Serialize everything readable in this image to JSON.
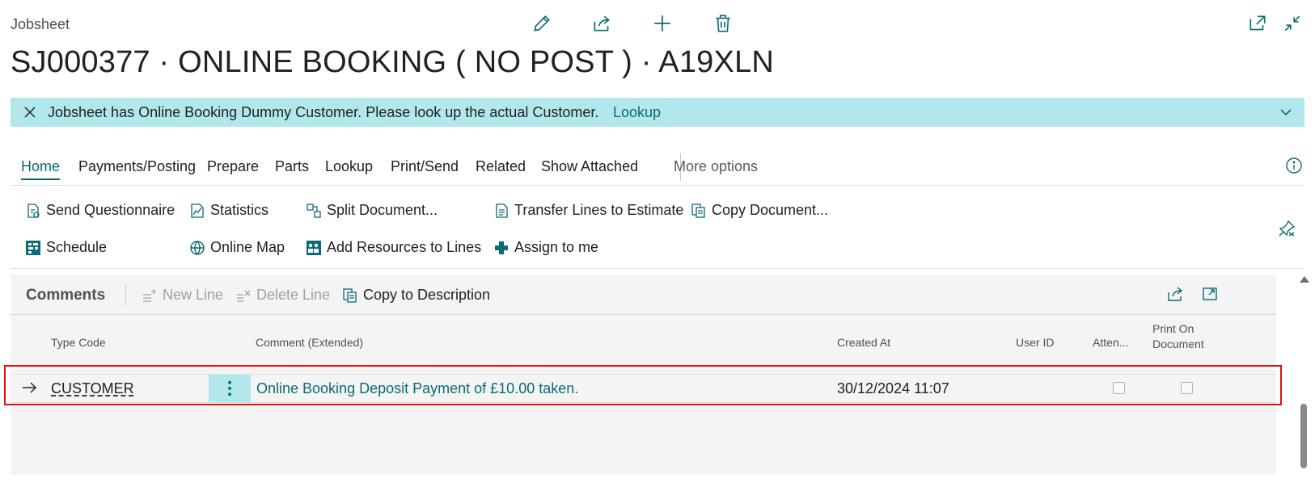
{
  "page": {
    "caption": "Jobsheet",
    "title": "SJ000377 · ONLINE BOOKING ( NO POST ) · A19XLN"
  },
  "top_icons": [
    "edit-icon",
    "share-icon",
    "add-icon",
    "delete-icon",
    "open-new-window-icon",
    "collapse-icon"
  ],
  "notification": {
    "message": "Jobsheet has Online Booking Dummy Customer. Please look up the actual Customer.",
    "link": "Lookup"
  },
  "tabs": [
    {
      "label": "Home",
      "active": true
    },
    {
      "label": "Payments/Posting"
    },
    {
      "label": "Prepare"
    },
    {
      "label": "Parts"
    },
    {
      "label": "Lookup"
    },
    {
      "label": "Print/Send"
    },
    {
      "label": "Related"
    },
    {
      "label": "Show Attached"
    },
    {
      "label": "More options"
    }
  ],
  "actions": {
    "send_questionnaire": "Send Questionnaire",
    "statistics": "Statistics",
    "split_document": "Split Document...",
    "transfer_lines": "Transfer Lines to Estimate",
    "copy_document": "Copy Document...",
    "schedule": "Schedule",
    "online_map": "Online Map",
    "add_resources": "Add Resources to Lines",
    "assign_to_me": "Assign to me"
  },
  "comments": {
    "title": "Comments",
    "new_line": "New Line",
    "delete_line": "Delete Line",
    "copy_to_description": "Copy to Description",
    "columns": {
      "type_code": "Type Code",
      "comment": "Comment (Extended)",
      "created_at": "Created At",
      "user_id": "User ID",
      "attention": "Atten...",
      "print_on_document_1": "Print On",
      "print_on_document_2": "Document"
    },
    "rows": [
      {
        "type_code": "CUSTOMER",
        "comment": "Online Booking Deposit Payment of £10.00 taken.",
        "created_at": "30/12/2024 11:07",
        "user_id": "",
        "attention": false,
        "print_on_document": false
      }
    ]
  },
  "colors": {
    "accent": "#0b6a73",
    "notification_bg": "#b2e8eb",
    "highlight_border": "#e01010"
  }
}
